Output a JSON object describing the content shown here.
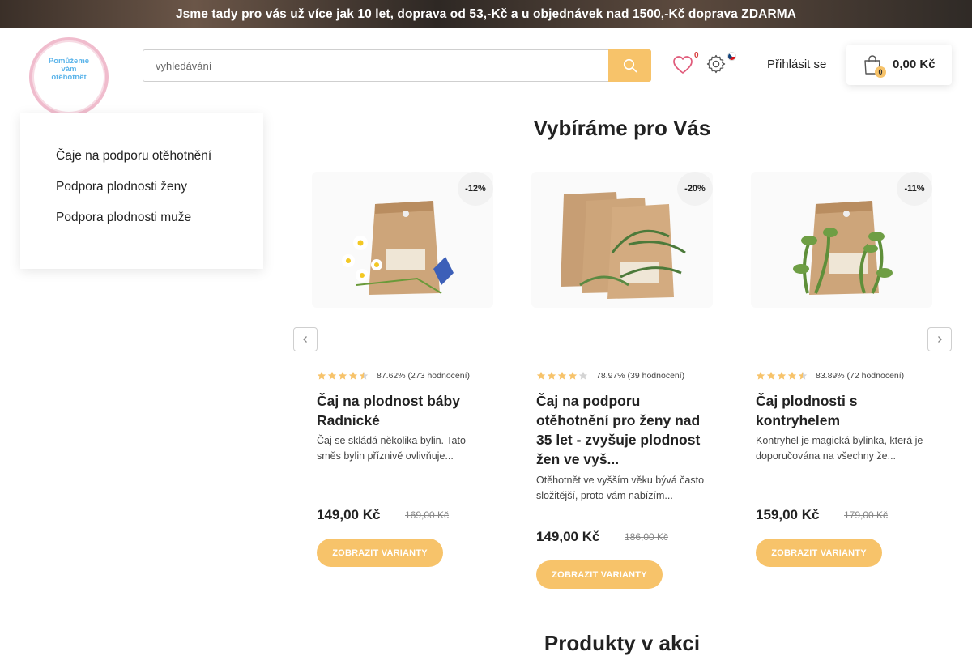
{
  "announcement": "Jsme tady pro vás už více jak 10 let, doprava od 53,-Kč a u objednávek nad 1500,-Kč doprava ZDARMA",
  "logo": {
    "text_line1": "Pomůžeme",
    "text_line2": "vám",
    "text_line3": "otěhotnět"
  },
  "search": {
    "placeholder": "vyhledávání",
    "value": ""
  },
  "header": {
    "wishlist_count": "0",
    "login_label": "Přihlásit se",
    "cart_count": "0",
    "cart_total": "0,00 Kč"
  },
  "sidebar": {
    "items": [
      {
        "label": "Čaje na podporu otěhotnění"
      },
      {
        "label": "Podpora plodnosti ženy"
      },
      {
        "label": "Podpora plodnosti muže"
      }
    ]
  },
  "sections": {
    "recommended_title": "Vybíráme pro Vás",
    "sale_title": "Produkty v akci"
  },
  "products": [
    {
      "discount": "-12%",
      "rating_text": "87.62% (273 hodnocení)",
      "stars": 4.5,
      "name": "Čaj na plodnost báby Radnické",
      "desc": "Čaj se skládá několika bylin. Tato směs bylin příznivě ovlivňuje...",
      "price": "149,00 Kč",
      "old_price": "169,00 Kč",
      "button": "ZOBRAZIT VARIANTY"
    },
    {
      "discount": "-20%",
      "rating_text": "78.97% (39 hodnocení)",
      "stars": 4,
      "name": "Čaj na podporu otěhotnění pro ženy nad 35 let - zvyšuje plodnost žen ve vyš...",
      "desc": "Otěhotnět ve vyšším věku bývá často složitější, proto vám nabízím...",
      "price": "149,00 Kč",
      "old_price": "186,00 Kč",
      "button": "ZOBRAZIT VARIANTY"
    },
    {
      "discount": "-11%",
      "rating_text": "83.89% (72 hodnocení)",
      "stars": 4.5,
      "name": "Čaj plodnosti s kontryhelem",
      "desc": "Kontryhel je magická bylinka, která je doporučována na všechny že...",
      "price": "159,00 Kč",
      "old_price": "179,00 Kč",
      "button": "ZOBRAZIT VARIANTY"
    }
  ],
  "colors": {
    "accent": "#f7c36a",
    "star": "#f7c36a",
    "logo_ring": "#f0bccd",
    "logo_text": "#5bb4ea"
  }
}
